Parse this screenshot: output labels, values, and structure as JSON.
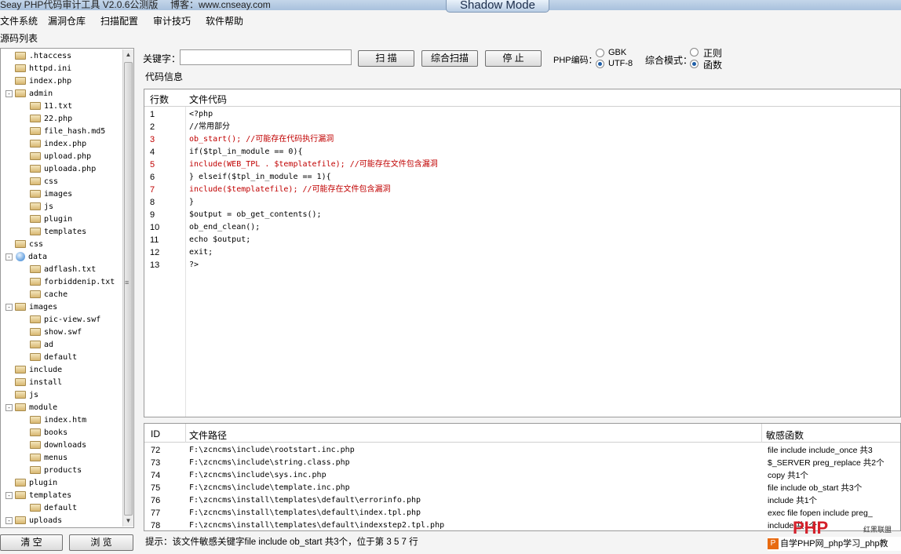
{
  "window": {
    "title": "Seay PHP代码审计工具 V2.0.6公测版",
    "record": "博客：www.cnseay.com",
    "shadow_mode": "Shadow Mode"
  },
  "menu": [
    "文件系统",
    "漏洞仓库",
    "扫描配置",
    "审计技巧",
    "软件帮助"
  ],
  "tree": {
    "label": "源码列表",
    "items": [
      {
        "name": ".htaccess",
        "level": 1,
        "toggle": ""
      },
      {
        "name": "httpd.ini",
        "level": 1,
        "toggle": ""
      },
      {
        "name": "index.php",
        "level": 1,
        "toggle": ""
      },
      {
        "name": "admin",
        "level": 1,
        "toggle": "-"
      },
      {
        "name": "11.txt",
        "level": 2,
        "toggle": ""
      },
      {
        "name": "22.php",
        "level": 2,
        "toggle": ""
      },
      {
        "name": "file_hash.md5",
        "level": 2,
        "toggle": ""
      },
      {
        "name": "index.php",
        "level": 2,
        "toggle": ""
      },
      {
        "name": "upload.php",
        "level": 2,
        "toggle": ""
      },
      {
        "name": "uploada.php",
        "level": 2,
        "toggle": ""
      },
      {
        "name": "css",
        "level": 2,
        "toggle": ""
      },
      {
        "name": "images",
        "level": 2,
        "toggle": ""
      },
      {
        "name": "js",
        "level": 2,
        "toggle": ""
      },
      {
        "name": "plugin",
        "level": 2,
        "toggle": ""
      },
      {
        "name": "templates",
        "level": 2,
        "toggle": ""
      },
      {
        "name": "css",
        "level": 1,
        "toggle": ""
      },
      {
        "name": "data",
        "level": 1,
        "toggle": "-",
        "icon": "globe"
      },
      {
        "name": "adflash.txt",
        "level": 2,
        "toggle": ""
      },
      {
        "name": "forbiddenip.txt",
        "level": 2,
        "toggle": ""
      },
      {
        "name": "cache",
        "level": 2,
        "toggle": ""
      },
      {
        "name": "images",
        "level": 1,
        "toggle": "-"
      },
      {
        "name": "pic-view.swf",
        "level": 2,
        "toggle": ""
      },
      {
        "name": "show.swf",
        "level": 2,
        "toggle": ""
      },
      {
        "name": "ad",
        "level": 2,
        "toggle": ""
      },
      {
        "name": "default",
        "level": 2,
        "toggle": ""
      },
      {
        "name": "include",
        "level": 1,
        "toggle": ""
      },
      {
        "name": "install",
        "level": 1,
        "toggle": ""
      },
      {
        "name": "js",
        "level": 1,
        "toggle": ""
      },
      {
        "name": "module",
        "level": 1,
        "toggle": "-"
      },
      {
        "name": "index.htm",
        "level": 2,
        "toggle": ""
      },
      {
        "name": "books",
        "level": 2,
        "toggle": ""
      },
      {
        "name": "downloads",
        "level": 2,
        "toggle": ""
      },
      {
        "name": "menus",
        "level": 2,
        "toggle": ""
      },
      {
        "name": "products",
        "level": 2,
        "toggle": ""
      },
      {
        "name": "plugin",
        "level": 1,
        "toggle": ""
      },
      {
        "name": "templates",
        "level": 1,
        "toggle": "-"
      },
      {
        "name": "default",
        "level": 2,
        "toggle": ""
      },
      {
        "name": "uploads",
        "level": 1,
        "toggle": "-"
      }
    ],
    "clear_button": "清 空",
    "browse_button": "浏 览"
  },
  "toolbar": {
    "keyword_label": "关键字：",
    "keyword_value": "",
    "scan_button": "扫 描",
    "full_scan_button": "综合扫描",
    "stop_button": "停 止",
    "encoding_label": "PHP编码：",
    "encoding_options": [
      {
        "label": "GBK",
        "selected": false
      },
      {
        "label": "UTF-8",
        "selected": true
      }
    ],
    "mode_label": "综合模式：",
    "mode_options": [
      {
        "label": "正则",
        "selected": false
      },
      {
        "label": "函数",
        "selected": true
      }
    ]
  },
  "code": {
    "section_label": "代码信息",
    "col_line": "行数",
    "col_code": "文件代码",
    "highlight_color": "#c00000",
    "rows": [
      {
        "ln": "1",
        "text": "<?php",
        "hl": false
      },
      {
        "ln": "2",
        "text": "//常用部分",
        "hl": false
      },
      {
        "ln": "3",
        "text": "ob_start();   //可能存在代码执行漏洞",
        "hl": true
      },
      {
        "ln": "4",
        "text": "if($tpl_in_module == 0){",
        "hl": false
      },
      {
        "ln": "5",
        "text": "include(WEB_TPL . $templatefile);   //可能存在文件包含漏洞",
        "hl": true
      },
      {
        "ln": "6",
        "text": "} elseif($tpl_in_module == 1){",
        "hl": false
      },
      {
        "ln": "7",
        "text": "include($templatefile);   //可能存在文件包含漏洞",
        "hl": true
      },
      {
        "ln": "8",
        "text": "}",
        "hl": false
      },
      {
        "ln": "9",
        "text": "$output = ob_get_contents();",
        "hl": false
      },
      {
        "ln": "10",
        "text": "ob_end_clean();",
        "hl": false
      },
      {
        "ln": "11",
        "text": "echo $output;",
        "hl": false
      },
      {
        "ln": "12",
        "text": "exit;",
        "hl": false
      },
      {
        "ln": "13",
        "text": "?>",
        "hl": false
      }
    ]
  },
  "results": {
    "col_id": "ID",
    "col_path": "文件路径",
    "col_func": "敏感函数",
    "rows": [
      {
        "id": "72",
        "path": "F:\\zcncms\\include\\rootstart.inc.php",
        "func": "file include include_once 共3"
      },
      {
        "id": "73",
        "path": "F:\\zcncms\\include\\string.class.php",
        "func": "$_SERVER preg_replace 共2个"
      },
      {
        "id": "74",
        "path": "F:\\zcncms\\include\\sys.inc.php",
        "func": "copy 共1个"
      },
      {
        "id": "75",
        "path": "F:\\zcncms\\include\\template.inc.php",
        "func": "file include ob_start 共3个"
      },
      {
        "id": "76",
        "path": "F:\\zcncms\\install\\templates\\default\\errorinfo.php",
        "func": "include 共1个"
      },
      {
        "id": "77",
        "path": "F:\\zcncms\\install\\templates\\default\\index.tpl.php",
        "func": "exec file fopen include preg_"
      },
      {
        "id": "78",
        "path": "F:\\zcncms\\install\\templates\\default\\indexstep2.tpl.php",
        "func": "include 共1个"
      }
    ]
  },
  "status": {
    "hint": "提示：该文件敏感关键字file include ob_start 共3个，位于第 3 5 7 行"
  },
  "watermark": {
    "logo": "PHP",
    "brand": "红黑联盟",
    "caption": "自学PHP网_php学习_php教"
  }
}
